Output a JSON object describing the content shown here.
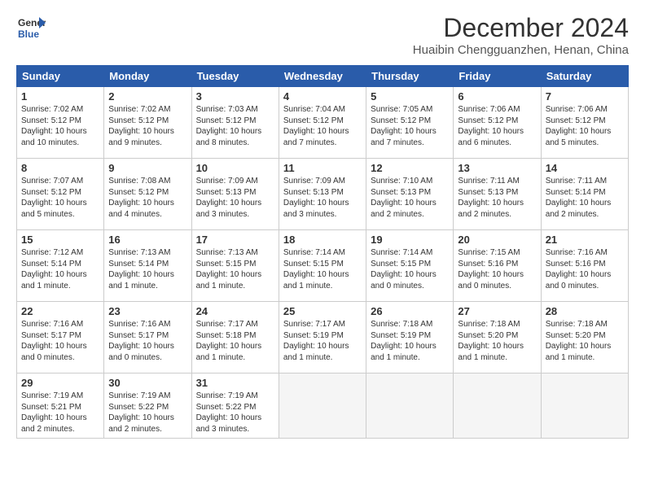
{
  "logo": {
    "text_general": "General",
    "text_blue": "Blue"
  },
  "title": "December 2024",
  "location": "Huaibin Chengguanzhen, Henan, China",
  "days_of_week": [
    "Sunday",
    "Monday",
    "Tuesday",
    "Wednesday",
    "Thursday",
    "Friday",
    "Saturday"
  ],
  "weeks": [
    [
      {
        "day": "1",
        "info": "Sunrise: 7:02 AM\nSunset: 5:12 PM\nDaylight: 10 hours\nand 10 minutes."
      },
      {
        "day": "2",
        "info": "Sunrise: 7:02 AM\nSunset: 5:12 PM\nDaylight: 10 hours\nand 9 minutes."
      },
      {
        "day": "3",
        "info": "Sunrise: 7:03 AM\nSunset: 5:12 PM\nDaylight: 10 hours\nand 8 minutes."
      },
      {
        "day": "4",
        "info": "Sunrise: 7:04 AM\nSunset: 5:12 PM\nDaylight: 10 hours\nand 7 minutes."
      },
      {
        "day": "5",
        "info": "Sunrise: 7:05 AM\nSunset: 5:12 PM\nDaylight: 10 hours\nand 7 minutes."
      },
      {
        "day": "6",
        "info": "Sunrise: 7:06 AM\nSunset: 5:12 PM\nDaylight: 10 hours\nand 6 minutes."
      },
      {
        "day": "7",
        "info": "Sunrise: 7:06 AM\nSunset: 5:12 PM\nDaylight: 10 hours\nand 5 minutes."
      }
    ],
    [
      {
        "day": "8",
        "info": "Sunrise: 7:07 AM\nSunset: 5:12 PM\nDaylight: 10 hours\nand 5 minutes."
      },
      {
        "day": "9",
        "info": "Sunrise: 7:08 AM\nSunset: 5:12 PM\nDaylight: 10 hours\nand 4 minutes."
      },
      {
        "day": "10",
        "info": "Sunrise: 7:09 AM\nSunset: 5:13 PM\nDaylight: 10 hours\nand 3 minutes."
      },
      {
        "day": "11",
        "info": "Sunrise: 7:09 AM\nSunset: 5:13 PM\nDaylight: 10 hours\nand 3 minutes."
      },
      {
        "day": "12",
        "info": "Sunrise: 7:10 AM\nSunset: 5:13 PM\nDaylight: 10 hours\nand 2 minutes."
      },
      {
        "day": "13",
        "info": "Sunrise: 7:11 AM\nSunset: 5:13 PM\nDaylight: 10 hours\nand 2 minutes."
      },
      {
        "day": "14",
        "info": "Sunrise: 7:11 AM\nSunset: 5:14 PM\nDaylight: 10 hours\nand 2 minutes."
      }
    ],
    [
      {
        "day": "15",
        "info": "Sunrise: 7:12 AM\nSunset: 5:14 PM\nDaylight: 10 hours\nand 1 minute."
      },
      {
        "day": "16",
        "info": "Sunrise: 7:13 AM\nSunset: 5:14 PM\nDaylight: 10 hours\nand 1 minute."
      },
      {
        "day": "17",
        "info": "Sunrise: 7:13 AM\nSunset: 5:15 PM\nDaylight: 10 hours\nand 1 minute."
      },
      {
        "day": "18",
        "info": "Sunrise: 7:14 AM\nSunset: 5:15 PM\nDaylight: 10 hours\nand 1 minute."
      },
      {
        "day": "19",
        "info": "Sunrise: 7:14 AM\nSunset: 5:15 PM\nDaylight: 10 hours\nand 0 minutes."
      },
      {
        "day": "20",
        "info": "Sunrise: 7:15 AM\nSunset: 5:16 PM\nDaylight: 10 hours\nand 0 minutes."
      },
      {
        "day": "21",
        "info": "Sunrise: 7:16 AM\nSunset: 5:16 PM\nDaylight: 10 hours\nand 0 minutes."
      }
    ],
    [
      {
        "day": "22",
        "info": "Sunrise: 7:16 AM\nSunset: 5:17 PM\nDaylight: 10 hours\nand 0 minutes."
      },
      {
        "day": "23",
        "info": "Sunrise: 7:16 AM\nSunset: 5:17 PM\nDaylight: 10 hours\nand 0 minutes."
      },
      {
        "day": "24",
        "info": "Sunrise: 7:17 AM\nSunset: 5:18 PM\nDaylight: 10 hours\nand 1 minute."
      },
      {
        "day": "25",
        "info": "Sunrise: 7:17 AM\nSunset: 5:19 PM\nDaylight: 10 hours\nand 1 minute."
      },
      {
        "day": "26",
        "info": "Sunrise: 7:18 AM\nSunset: 5:19 PM\nDaylight: 10 hours\nand 1 minute."
      },
      {
        "day": "27",
        "info": "Sunrise: 7:18 AM\nSunset: 5:20 PM\nDaylight: 10 hours\nand 1 minute."
      },
      {
        "day": "28",
        "info": "Sunrise: 7:18 AM\nSunset: 5:20 PM\nDaylight: 10 hours\nand 1 minute."
      }
    ],
    [
      {
        "day": "29",
        "info": "Sunrise: 7:19 AM\nSunset: 5:21 PM\nDaylight: 10 hours\nand 2 minutes."
      },
      {
        "day": "30",
        "info": "Sunrise: 7:19 AM\nSunset: 5:22 PM\nDaylight: 10 hours\nand 2 minutes."
      },
      {
        "day": "31",
        "info": "Sunrise: 7:19 AM\nSunset: 5:22 PM\nDaylight: 10 hours\nand 3 minutes."
      },
      {
        "day": "",
        "info": ""
      },
      {
        "day": "",
        "info": ""
      },
      {
        "day": "",
        "info": ""
      },
      {
        "day": "",
        "info": ""
      }
    ]
  ]
}
